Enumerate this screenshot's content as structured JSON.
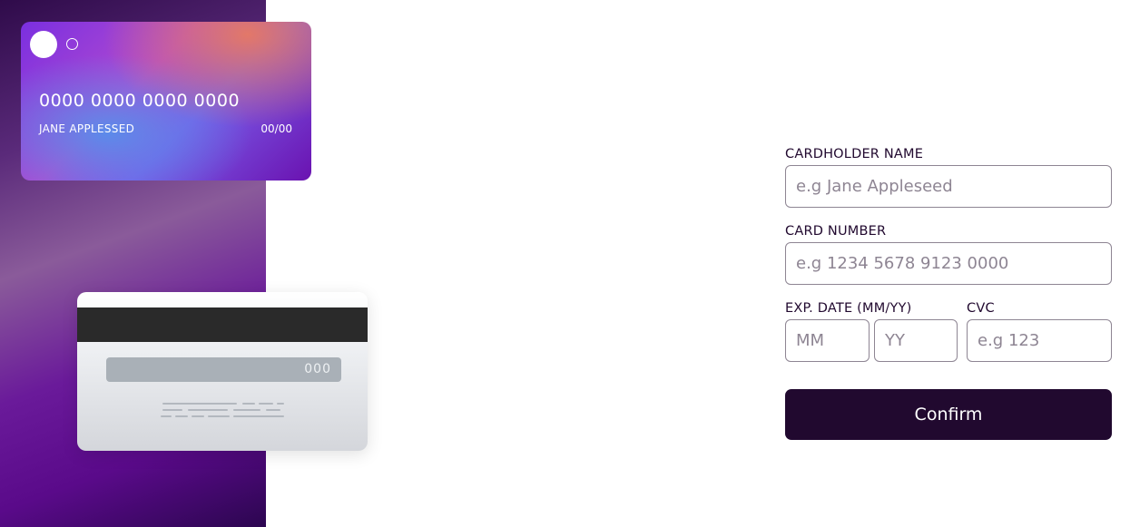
{
  "card_front": {
    "number": "0000 0000 0000 0000",
    "name": "JANE APPLESSED",
    "expiry": "00/00"
  },
  "card_back": {
    "cvc": "000"
  },
  "form": {
    "name_label": "CARDHOLDER NAME",
    "name_placeholder": "e.g Jane Appleseed",
    "number_label": "CARD NUMBER",
    "number_placeholder": "e.g 1234 5678 9123 0000",
    "exp_label": "EXP. DATE (MM/YY)",
    "month_placeholder": "MM",
    "year_placeholder": "YY",
    "cvc_label": "CVC",
    "cvc_placeholder": "e.g 123",
    "confirm_label": "Confirm"
  },
  "colors": {
    "dark_violet": "#21092f",
    "grayish_violet": "#8e8593"
  }
}
